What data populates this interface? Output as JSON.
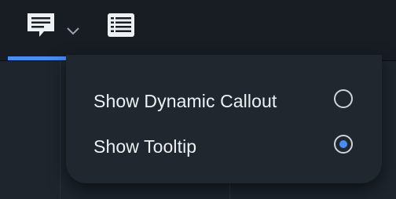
{
  "toolbar": {
    "tabs": [
      {
        "icon": "callout-comment-icon",
        "selected": true,
        "has_dropdown": true
      },
      {
        "icon": "list-view-icon",
        "selected": false,
        "has_dropdown": false
      }
    ],
    "accent_color": "#4a8cf0"
  },
  "menu": {
    "options": [
      {
        "label": "Show Dynamic Callout",
        "selected": false
      },
      {
        "label": "Show Tooltip",
        "selected": true
      }
    ]
  }
}
